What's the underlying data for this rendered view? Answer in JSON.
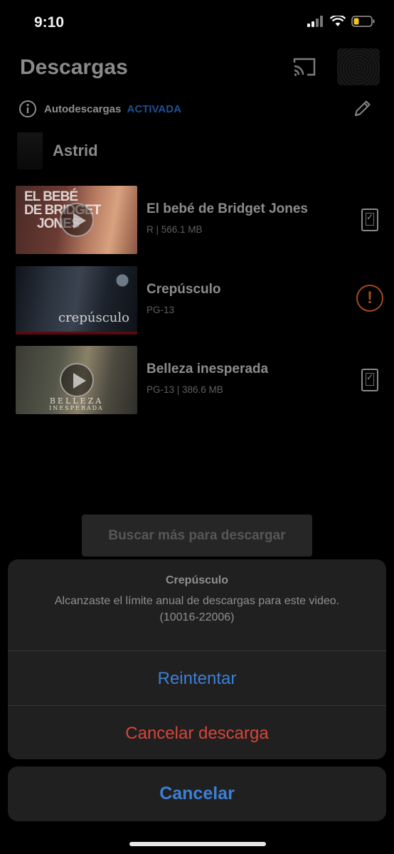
{
  "status_bar": {
    "time": "9:10"
  },
  "header": {
    "title": "Descargas"
  },
  "auto_downloads": {
    "label": "Autodescargas",
    "status": "ACTIVADA"
  },
  "profile": {
    "name": "Astrid"
  },
  "downloads": [
    {
      "title": "El bebé de Bridget Jones",
      "meta": "R | 566.1 MB",
      "thumb_text": [
        "EL BEBÉ",
        "DE BRIDGET",
        "JONES"
      ]
    },
    {
      "title": "Crepúsculo",
      "meta": "PG-13",
      "thumb_text": [
        "crepúsculo"
      ]
    },
    {
      "title": "Belleza inesperada",
      "meta": "PG-13 | 386.6 MB",
      "thumb_text": [
        "BELLEZA",
        "INESPERADA"
      ]
    }
  ],
  "find_more_button": "Buscar más para descargar",
  "action_sheet": {
    "title": "Crepúsculo",
    "message_line1": "Alcanzaste el límite anual de descargas para este video.",
    "message_line2": "(10016-22006)",
    "retry": "Reintentar",
    "cancel_download": "Cancelar descarga",
    "cancel": "Cancelar"
  },
  "colors": {
    "accent_blue": "#3d7fd6",
    "destructive_red": "#d84539",
    "warning_orange": "#a4491e"
  },
  "icons": [
    "cast-icon",
    "info-icon",
    "pencil-icon",
    "play-icon",
    "device-check-icon",
    "alert-icon"
  ]
}
